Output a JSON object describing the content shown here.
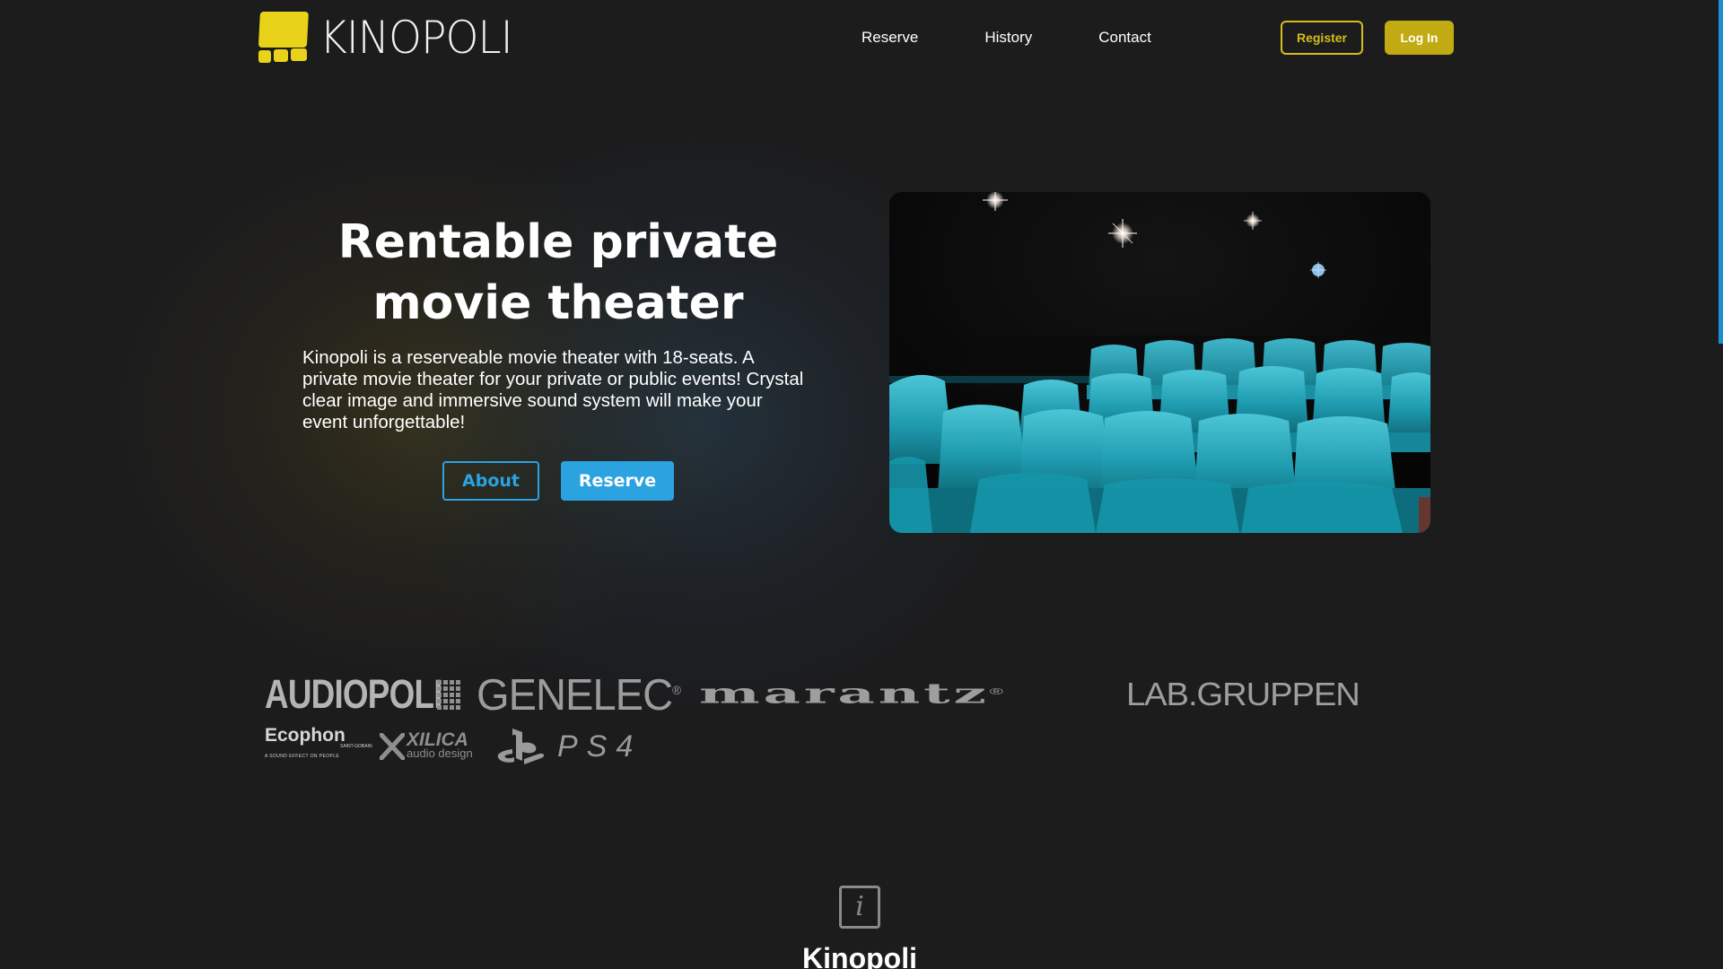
{
  "brand": {
    "name": "KINOPOLI",
    "logo_color": "#e8d21a"
  },
  "nav": {
    "items": [
      "Reserve",
      "History",
      "Contact"
    ]
  },
  "auth": {
    "register_label": "Register",
    "login_label": "Log In",
    "accent": "#c2aa12"
  },
  "hero": {
    "title": "Rentable private movie theater",
    "description": "Kinopoli is a reserveable movie theater with 18-seats. A private movie theater for your private or public events! Crystal clear image and immersive sound system will make your event unforgettable!",
    "about_label": "About",
    "reserve_label": "Reserve",
    "accent": "#2aa3e0",
    "image_subject": "teal theater seats under a starry ceiling"
  },
  "partners": {
    "audiopoli": "AUDIOPOLI",
    "genelec": "GENELEC",
    "genelec_mark": "®",
    "marantz": "marantz",
    "marantz_mark": "®",
    "labgruppen": "LAB.GRUPPEN",
    "ecophon": "Ecophon",
    "ecophon_sub": "SAINT-GOBAIN",
    "ecophon_tagline": "A SOUND EFFECT ON PEOPLE",
    "xilica": "XILICA",
    "xilica_sub": "audio design",
    "ps4": "PS4"
  },
  "info": {
    "icon": "info-icon",
    "icon_glyph": "i",
    "title": "Kinopoli"
  },
  "scrollbar": {
    "color": "#1c8fd0"
  }
}
